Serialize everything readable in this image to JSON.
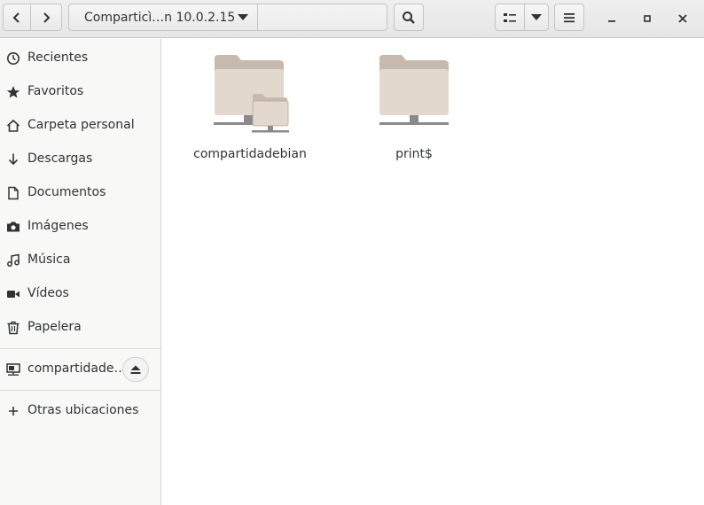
{
  "header": {
    "back_icon": "go-previous-icon",
    "forward_icon": "go-next-icon",
    "path_label": "Comparticì…n 10.0.2.15",
    "search_icon": "search-icon",
    "view_icon": "list-view-icon",
    "view_menu_icon": "chevron-down-icon",
    "menu_icon": "hamburger-menu-icon",
    "window": {
      "minimize": "minimize-icon",
      "maximize": "maximize-icon",
      "close": "close-icon"
    }
  },
  "sidebar": {
    "places": [
      {
        "label": "Recientes",
        "icon": "clock-icon"
      },
      {
        "label": "Favoritos",
        "icon": "star-icon"
      },
      {
        "label": "Carpeta personal",
        "icon": "home-icon"
      },
      {
        "label": "Descargas",
        "icon": "download-icon"
      },
      {
        "label": "Documentos",
        "icon": "document-icon"
      },
      {
        "label": "Imágenes",
        "icon": "camera-icon"
      },
      {
        "label": "Música",
        "icon": "music-icon"
      },
      {
        "label": "Vídeos",
        "icon": "video-icon"
      },
      {
        "label": "Papelera",
        "icon": "trash-icon"
      }
    ],
    "mount": {
      "label": "compartidade…",
      "icon": "network-folder-icon",
      "eject_icon": "eject-icon"
    },
    "other": {
      "label": "Otras ubicaciones",
      "icon": "plus-icon"
    }
  },
  "files": [
    {
      "name": "compartidadebian",
      "icon": "network-share-folder-icon"
    },
    {
      "name": "print$",
      "icon": "network-share-folder-icon"
    }
  ],
  "colors": {
    "folder_back": "#c8b9ad",
    "folder_front": "#e3d8ce",
    "header_bg": "#e9e9e9",
    "sidebar_bg": "#f8f8f7"
  }
}
